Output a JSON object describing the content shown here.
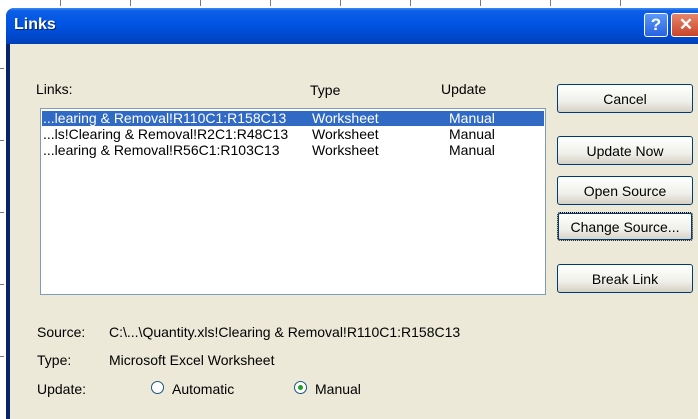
{
  "window": {
    "title": "Links",
    "help_label": "?",
    "close_label": "✕"
  },
  "list": {
    "header_links": "Links:",
    "header_type": "Type",
    "header_update": "Update",
    "rows": [
      {
        "link": "...learing & Removal!R110C1:R158C13",
        "type": "Worksheet",
        "update": "Manual",
        "selected": true
      },
      {
        "link": "...ls!Clearing & Removal!R2C1:R48C13",
        "type": "Worksheet",
        "update": "Manual",
        "selected": false
      },
      {
        "link": "...learing & Removal!R56C1:R103C13",
        "type": "Worksheet",
        "update": "Manual",
        "selected": false
      }
    ]
  },
  "buttons": {
    "cancel": "Cancel",
    "update_now": "Update Now",
    "open_source": "Open Source",
    "change_source": "Change Source...",
    "break_link": "Break Link"
  },
  "details": {
    "source_label": "Source:",
    "source_value": "C:\\...\\Quantity.xls!Clearing & Removal!R110C1:R158C13",
    "type_label": "Type:",
    "type_value": "Microsoft Excel Worksheet",
    "update_label": "Update:",
    "automatic_label": "Automatic",
    "manual_label": "Manual",
    "selected_update": "Manual"
  },
  "colors": {
    "titlebar": "#0054e3",
    "dialog_bg": "#ece9d8",
    "selection": "#316ac5"
  }
}
